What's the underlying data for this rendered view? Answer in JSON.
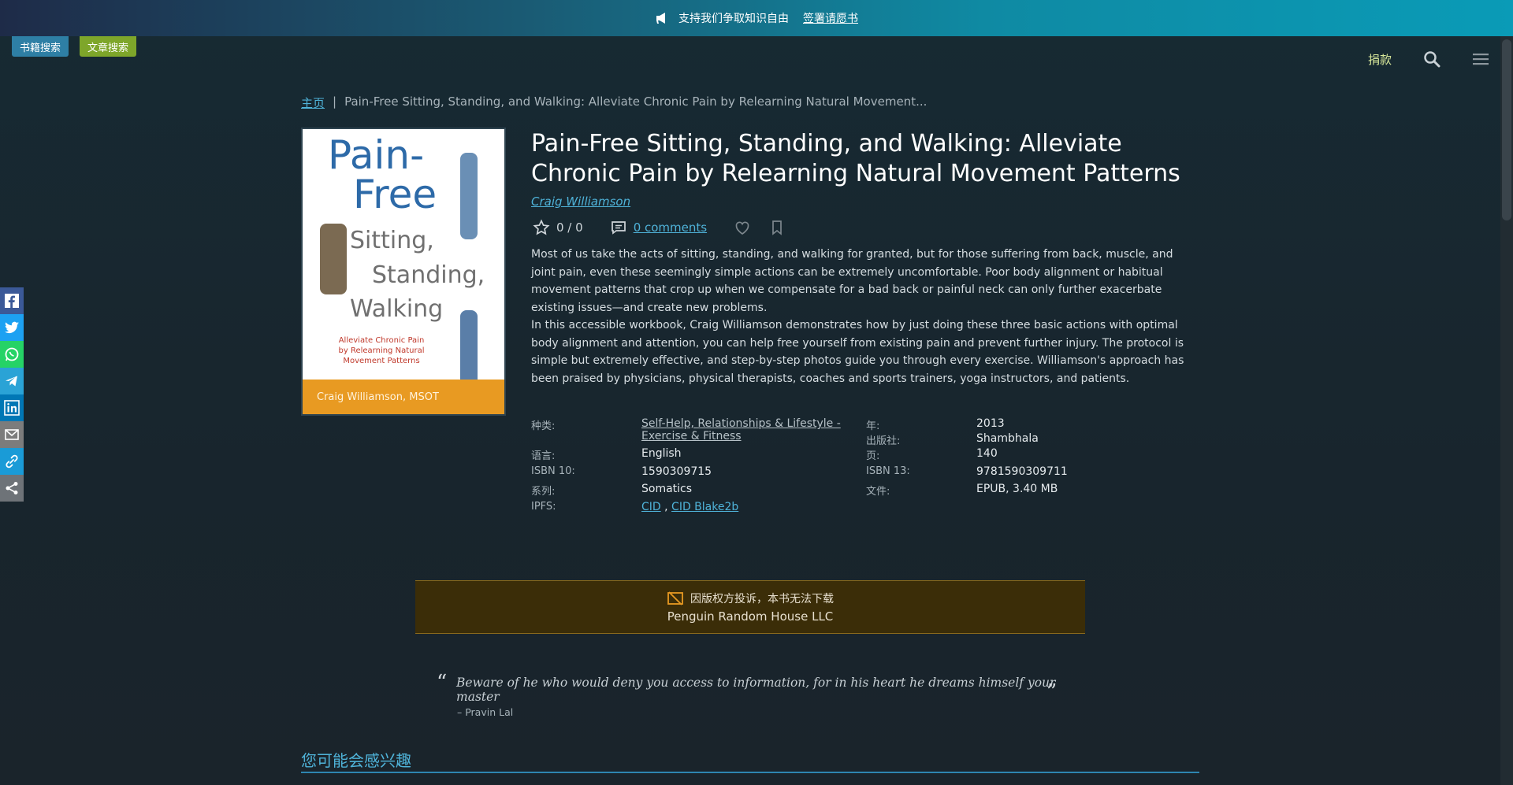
{
  "banner": {
    "text": "支持我们争取知识自由",
    "link": "签署请愿书"
  },
  "search_tabs": {
    "books": "书籍搜索",
    "articles": "文章搜索"
  },
  "nav": {
    "donate": "捐款"
  },
  "breadcrumb": {
    "home": "主页",
    "separator": "|",
    "current": "Pain-Free Sitting, Standing, and Walking: Alleviate Chronic Pain by Relearning Natural Movement..."
  },
  "cover": {
    "title_line1": "Pain-",
    "title_line2": "Free",
    "line3": "Sitting,",
    "line4": "Standing,",
    "line5": "Walking",
    "subtitle": "Alleviate Chronic Pain by Relearning Natural Movement Patterns",
    "author": "Craig Williamson, MSOT"
  },
  "book": {
    "title": "Pain-Free Sitting, Standing, and Walking: Alleviate Chronic Pain by Relearning Natural Movement Patterns",
    "author": "Craig Williamson",
    "rating": "0 / 0",
    "comments": "0 comments",
    "description_p1": "Most of us take the acts of sitting, standing, and walking for granted, but for those suffering from back, muscle, and joint pain, even these seemingly simple actions can be extremely uncomfortable. Poor body alignment or habitual movement patterns that crop up when we compensate for a bad back or painful neck can only further exacerbate existing issues—and create new problems.",
    "description_p2": "In this accessible workbook, Craig Williamson demonstrates how by just doing these three basic actions with optimal body alignment and attention, you can help free yourself from existing pain and prevent further injury. The protocol is simple but extremely effective, and step-by-step photos guide you through every exercise. Williamson's approach has been praised by physicians, physical therapists, coaches and sports trainers, yoga instructors, and patients."
  },
  "details": {
    "category_label": "种类:",
    "category_value_line1": "Self-Help, Relationships & Lifestyle -",
    "category_value_line2": "Exercise & Fitness",
    "year_label": "年:",
    "year_value": "2013",
    "publisher_label": "出版社:",
    "publisher_value": "Shambhala",
    "language_label": "语言:",
    "language_value": "English",
    "pages_label": "页:",
    "pages_value": "140",
    "isbn10_label": "ISBN 10:",
    "isbn10_value": "1590309715",
    "isbn13_label": "ISBN 13:",
    "isbn13_value": "9781590309711",
    "series_label": "系列:",
    "series_value": "Somatics",
    "file_label": "文件:",
    "file_value": "EPUB, 3.40 MB",
    "ipfs_label": "IPFS:",
    "ipfs_cid": "CID",
    "ipfs_sep": ",",
    "ipfs_blake": "CID Blake2b"
  },
  "notice": {
    "line1": "因版权方投诉，本书无法下载",
    "line2": "Penguin Random House LLC"
  },
  "quote": {
    "open": "“",
    "text": "Beware of he who would deny you access to information, for in his heart he dreams himself your master",
    "close": "”",
    "author": "– Pravin Lal"
  },
  "section": {
    "title": "您可能会感兴趣"
  },
  "colors": {
    "accent": "#4fb3d9",
    "notice_bg": "#3b2d08",
    "books_tab": "#2e7fa5",
    "articles_tab": "#7ea62a"
  }
}
